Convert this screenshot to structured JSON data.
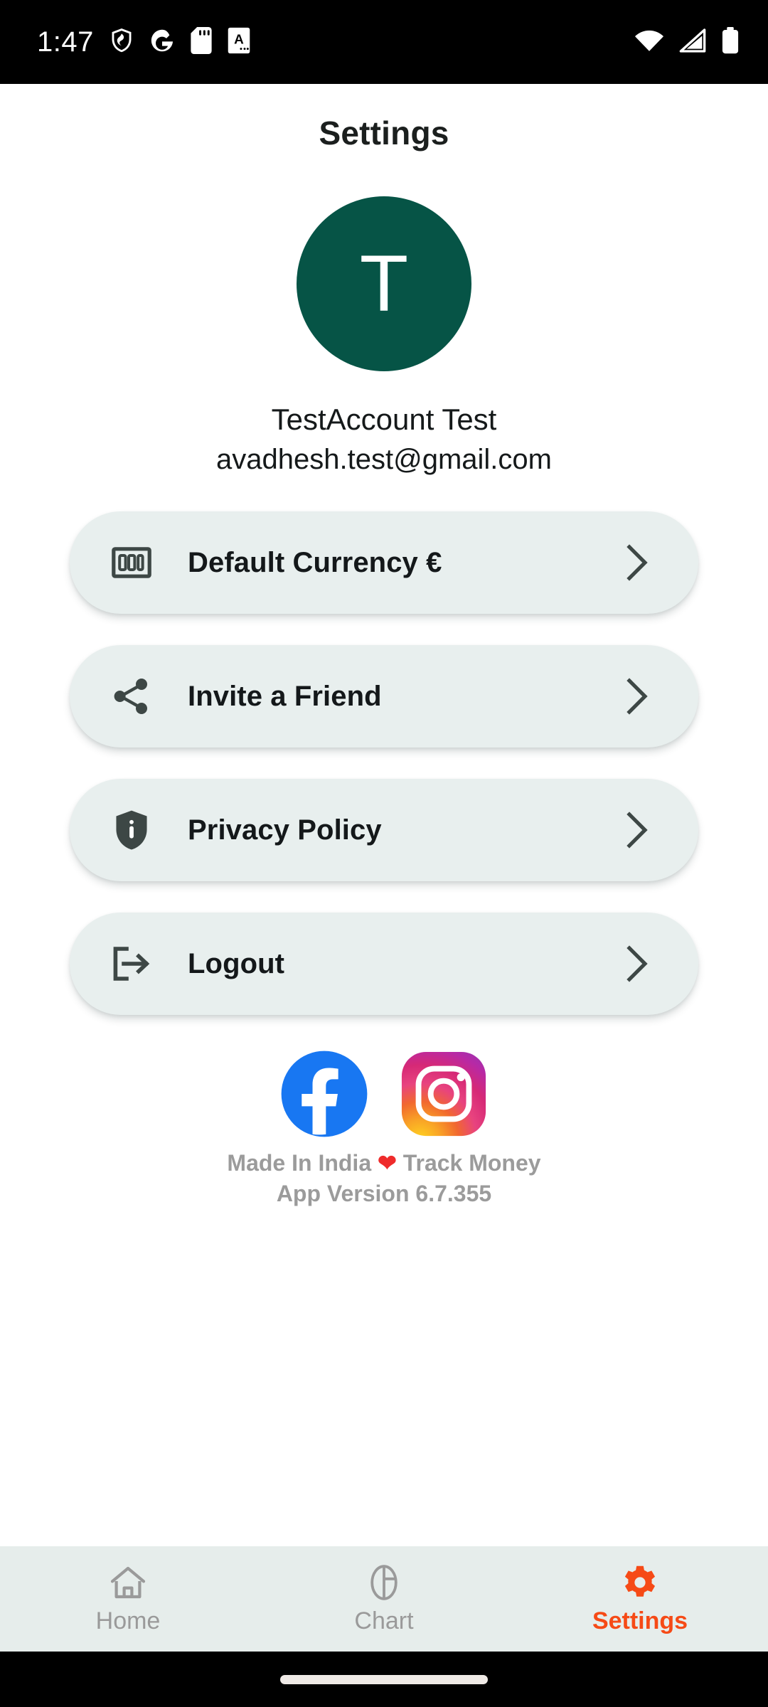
{
  "statusbar": {
    "time": "1:47",
    "left_icons": [
      "shield-icon",
      "google-g-icon",
      "sd-card-icon",
      "document-a-icon"
    ],
    "right_icons": [
      "wifi-icon",
      "cellular-signal-icon",
      "battery-icon"
    ],
    "background": "#000000",
    "foreground": "#ffffff"
  },
  "header": {
    "title": "Settings"
  },
  "profile": {
    "avatar_initial": "T",
    "avatar_color": "#065446",
    "name": "TestAccount Test",
    "email": "avadhesh.test@gmail.com"
  },
  "menu": {
    "card_background": "#e8efee",
    "items": [
      {
        "label": "Default Currency €",
        "icon": "money-banknote-icon",
        "chevron": "chevron-right-icon"
      },
      {
        "label": "Invite a Friend",
        "icon": "share-icon",
        "chevron": "chevron-right-icon"
      },
      {
        "label": "Privacy Policy",
        "icon": "shield-info-icon",
        "chevron": "chevron-right-icon"
      },
      {
        "label": "Logout",
        "icon": "logout-exit-icon",
        "chevron": "chevron-right-icon"
      }
    ]
  },
  "social": {
    "items": [
      {
        "name": "facebook-icon",
        "color": "#1877f2"
      },
      {
        "name": "instagram-icon",
        "color": "#d62976"
      }
    ]
  },
  "footer": {
    "made_in_prefix": "Made In India ",
    "heart": "❤",
    "made_in_suffix": " Track Money",
    "version": "App Version 6.7.355",
    "text_color": "#9b9b9b"
  },
  "bottomnav": {
    "background": "#e6edeb",
    "active_color": "#f64a16",
    "inactive_color": "#9a9a9a",
    "items": [
      {
        "label": "Home",
        "icon": "home-icon",
        "active": false
      },
      {
        "label": "Chart",
        "icon": "pie-chart-icon",
        "active": false
      },
      {
        "label": "Settings",
        "icon": "gear-icon",
        "active": true
      }
    ]
  }
}
